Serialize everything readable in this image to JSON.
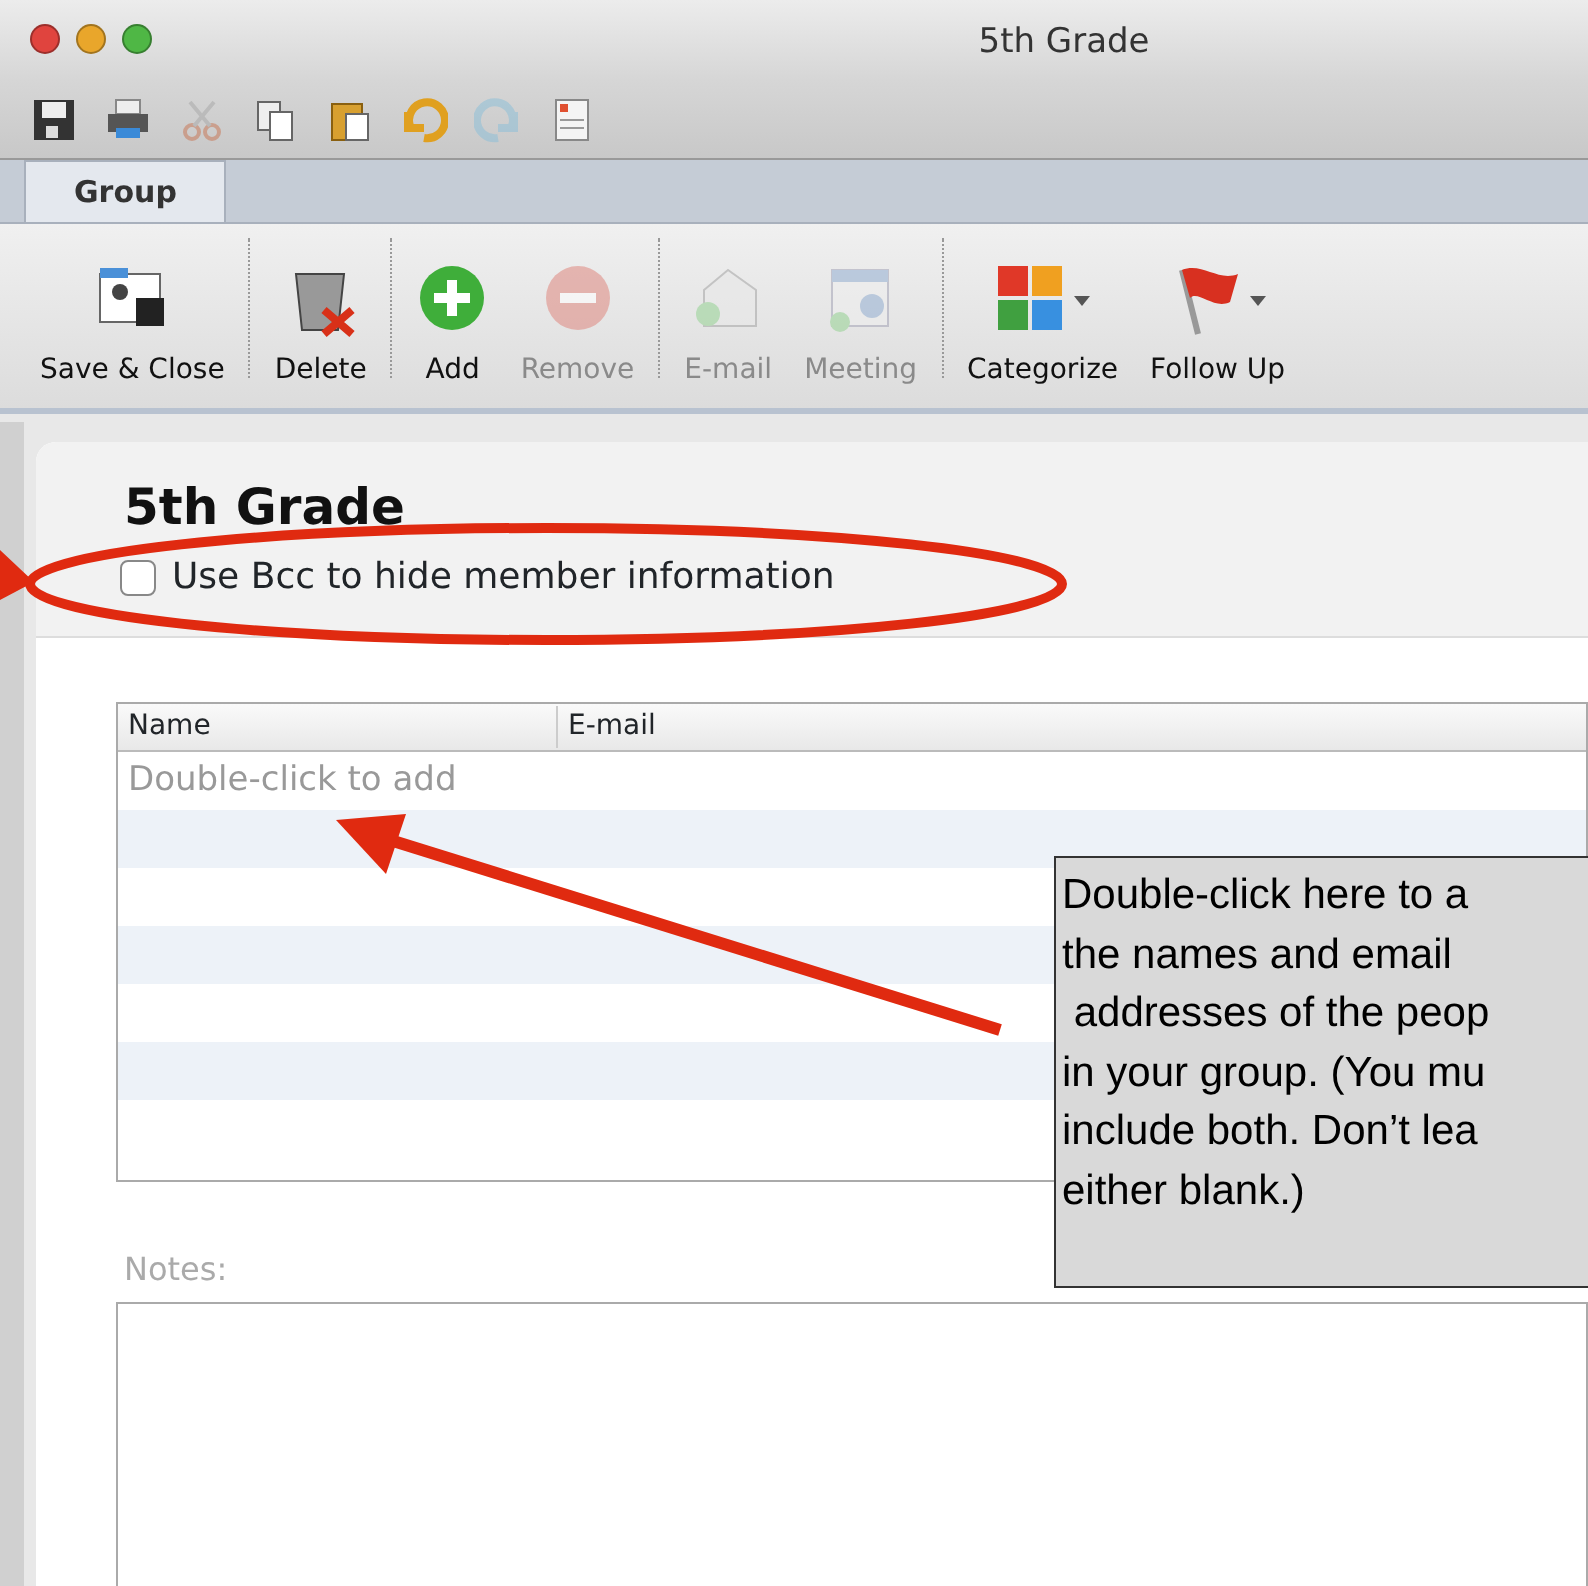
{
  "window": {
    "title": "5th Grade"
  },
  "quick_toolbar": [
    {
      "kind": "save"
    },
    {
      "kind": "print"
    },
    {
      "kind": "cut",
      "disabled": true
    },
    {
      "kind": "copy"
    },
    {
      "kind": "paste"
    },
    {
      "kind": "undo"
    },
    {
      "kind": "redo",
      "disabled": true
    },
    {
      "kind": "form"
    }
  ],
  "tabs": [
    {
      "label": "Group",
      "selected": true
    }
  ],
  "ribbon": [
    {
      "kind": "save-close",
      "label": "Save & Close",
      "disabled": false,
      "dropdown": false
    },
    {
      "kind": "delete",
      "label": "Delete",
      "disabled": false,
      "dropdown": false
    },
    {
      "kind": "add",
      "label": "Add",
      "disabled": false,
      "dropdown": false
    },
    {
      "kind": "remove",
      "label": "Remove",
      "disabled": true,
      "dropdown": false
    },
    {
      "kind": "email",
      "label": "E-mail",
      "disabled": true,
      "dropdown": false
    },
    {
      "kind": "meeting",
      "label": "Meeting",
      "disabled": true,
      "dropdown": false
    },
    {
      "kind": "categorize",
      "label": "Categorize",
      "disabled": false,
      "dropdown": true
    },
    {
      "kind": "flag",
      "label": "Follow Up",
      "disabled": false,
      "dropdown": true
    }
  ],
  "group": {
    "name": "5th Grade",
    "bcc": {
      "label": "Use Bcc to hide member information",
      "checked": false
    }
  },
  "members": {
    "columns": [
      "Name",
      "E-mail"
    ],
    "placeholder": "Double-click to add"
  },
  "notes": {
    "label": "Notes:"
  },
  "callout": {
    "lines": [
      "Double-click here to a",
      "the names and email",
      " addresses of the peop",
      "in your group. (You mu",
      "include both. Don’t lea",
      "either blank.)"
    ]
  }
}
